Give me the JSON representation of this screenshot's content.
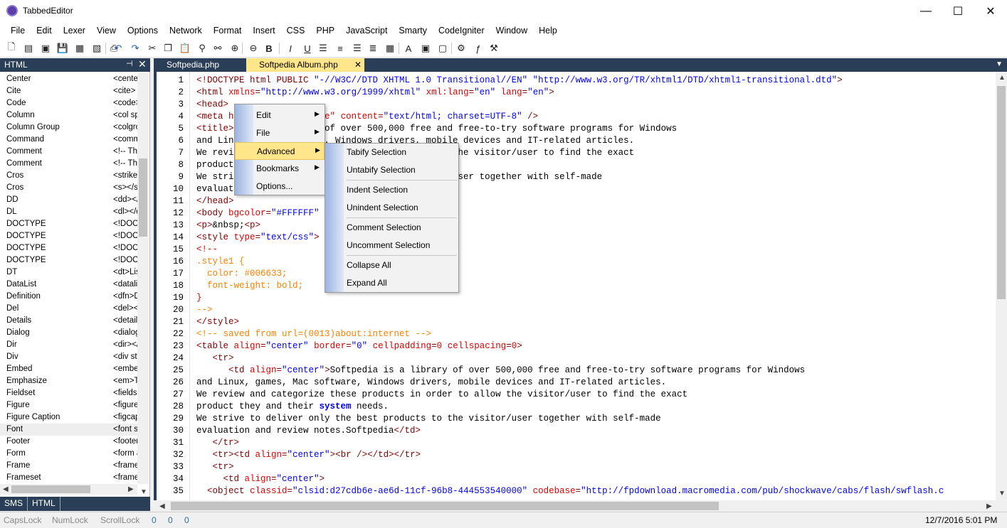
{
  "window": {
    "title": "TabbedEditor",
    "minimize": "—",
    "maximize": "☐",
    "close": "✕"
  },
  "menu": [
    "File",
    "Edit",
    "Lexer",
    "View",
    "Options",
    "Network",
    "Format",
    "Insert",
    "CSS",
    "PHP",
    "JavaScript",
    "Smarty",
    "CodeIgniter",
    "Window",
    "Help"
  ],
  "toolbar_icons": [
    "new-file-icon",
    "new-template-icon",
    "close-file-icon",
    "save-icon",
    "save-all-icon",
    "print-preview-icon",
    "print-icon",
    "undo-icon",
    "redo-icon",
    "cut-icon",
    "copy-icon",
    "paste-icon",
    "find-icon",
    "find-replace-icon",
    "zoom-in-icon",
    "zoom-out-icon",
    "bold-icon",
    "italic-icon",
    "underline-icon",
    "align-left-icon",
    "align-center-icon",
    "align-right-icon",
    "justify-icon",
    "table-icon",
    "font-icon",
    "image-icon",
    "comment-icon",
    "tools-icon",
    "function-icon",
    "run-icon"
  ],
  "panel": {
    "title": "HTML",
    "pin": "⊣",
    "close": "✕",
    "items": [
      {
        "name": "Center",
        "value": "<center"
      },
      {
        "name": "Cite",
        "value": "<cite>"
      },
      {
        "name": "Code",
        "value": "<code>"
      },
      {
        "name": "Column",
        "value": "<col sp"
      },
      {
        "name": "Column Group",
        "value": "<colgro"
      },
      {
        "name": "Command",
        "value": "<comm"
      },
      {
        "name": "Comment",
        "value": "<!-- Thi"
      },
      {
        "name": "Comment",
        "value": "<!-- Thi"
      },
      {
        "name": "Cros",
        "value": "<strike"
      },
      {
        "name": "Cros",
        "value": "<s></s"
      },
      {
        "name": "DD",
        "value": "<dd></"
      },
      {
        "name": "DL",
        "value": "<dl></d"
      },
      {
        "name": "DOCTYPE",
        "value": "<!DOC"
      },
      {
        "name": "DOCTYPE",
        "value": "<!DOC"
      },
      {
        "name": "DOCTYPE",
        "value": "<!DOC"
      },
      {
        "name": "DOCTYPE",
        "value": "<!DOC"
      },
      {
        "name": "DT",
        "value": "<dt>Lis"
      },
      {
        "name": "DataList",
        "value": "<datalis"
      },
      {
        "name": "Definition",
        "value": "<dfn>D"
      },
      {
        "name": "Del",
        "value": "<del><"
      },
      {
        "name": "Details",
        "value": "<details"
      },
      {
        "name": "Dialog",
        "value": "<dialog"
      },
      {
        "name": "Dir",
        "value": "<dir></"
      },
      {
        "name": "Div",
        "value": "<div sty"
      },
      {
        "name": "Embed",
        "value": "<embe"
      },
      {
        "name": "Emphasize",
        "value": "<em>T"
      },
      {
        "name": "Fieldset",
        "value": "<fieldse"
      },
      {
        "name": "Figure",
        "value": "<figure"
      },
      {
        "name": "Figure Caption",
        "value": "<figcap"
      },
      {
        "name": "Font",
        "value": "<font s"
      },
      {
        "name": "Footer",
        "value": "<footer"
      },
      {
        "name": "Form",
        "value": "<form a"
      },
      {
        "name": "Frame",
        "value": "<frame"
      },
      {
        "name": "Frameset",
        "value": "<frame"
      }
    ],
    "selected_index": 29,
    "tabs": [
      "SMS",
      "HTML"
    ]
  },
  "tabs": [
    {
      "label": "Softpedia.php",
      "active": false
    },
    {
      "label": "Softpedia Album.php",
      "active": true
    }
  ],
  "tab_close": "✕",
  "code_lines": [
    {
      "n": "1",
      "segs": [
        [
          "tag",
          "<!DOCTYPE html PUBLIC "
        ],
        [
          "str",
          "\"-//W3C//DTD XHTML 1.0 Transitional//EN\""
        ],
        [
          "text",
          " "
        ],
        [
          "str",
          "\"http://www.w3.org/TR/xhtml1/DTD/xhtml1-transitional.dtd\""
        ],
        [
          "tag",
          ">"
        ]
      ]
    },
    {
      "n": "2",
      "segs": [
        [
          "tag",
          "<html "
        ],
        [
          "attr",
          "xmlns"
        ],
        [
          "tag",
          "="
        ],
        [
          "str",
          "\"http://www.w3.org/1999/xhtml\""
        ],
        [
          "tag",
          " "
        ],
        [
          "attr",
          "xml:lang"
        ],
        [
          "tag",
          "="
        ],
        [
          "str",
          "\"en\""
        ],
        [
          "tag",
          " "
        ],
        [
          "attr",
          "lang"
        ],
        [
          "tag",
          "="
        ],
        [
          "str",
          "\"en\""
        ],
        [
          "tag",
          ">"
        ]
      ]
    },
    {
      "n": "3",
      "segs": [
        [
          "tag",
          "<head>"
        ]
      ]
    },
    {
      "n": "4",
      "segs": [
        [
          "tag",
          "<meta h"
        ],
        [
          "text",
          "          "
        ],
        [
          "attr",
          "ent-Type\""
        ],
        [
          "tag",
          " "
        ],
        [
          "attr",
          "content"
        ],
        [
          "tag",
          "="
        ],
        [
          "str",
          "\"text/html; charset=UTF-8\""
        ],
        [
          "tag",
          " />"
        ]
      ]
    },
    {
      "n": "5",
      "segs": [
        [
          "tag",
          "<title>"
        ],
        [
          "text",
          "          ibrary of over 500,000 free and free-to-try software programs for Windows"
        ]
      ]
    },
    {
      "n": "6",
      "segs": [
        [
          "text",
          "and Lin          oftware, Windows drivers, mobile devices and IT-related articles."
        ]
      ]
    },
    {
      "n": "7",
      "segs": [
        [
          "text",
          "We revi                             er to allow the visitor/user to find the exact"
        ]
      ]
    },
    {
      "n": "8",
      "segs": [
        [
          "text",
          "product"
        ]
      ]
    },
    {
      "n": "9",
      "segs": [
        [
          "text",
          "We stri                             the visitor/user together with self-made"
        ]
      ]
    },
    {
      "n": "10",
      "segs": [
        [
          "text",
          "evaluat"
        ]
      ]
    },
    {
      "n": "11",
      "segs": [
        [
          "tag",
          "</head>"
        ]
      ]
    },
    {
      "n": "12",
      "segs": [
        [
          "tag",
          "<body "
        ],
        [
          "attr",
          "bgcolor"
        ],
        [
          "tag",
          "="
        ],
        [
          "str",
          "\"#FFFFFF\""
        ]
      ]
    },
    {
      "n": "13",
      "segs": [
        [
          "tag",
          "<p>"
        ],
        [
          "text",
          "&nbsp;"
        ],
        [
          "tag",
          "<p>"
        ]
      ]
    },
    {
      "n": "14",
      "segs": [
        [
          "tag",
          "<style "
        ],
        [
          "attr",
          "type"
        ],
        [
          "tag",
          "="
        ],
        [
          "str",
          "\"text/css\""
        ],
        [
          "tag",
          ">"
        ]
      ]
    },
    {
      "n": "15",
      "segs": [
        [
          "attr",
          "<!--"
        ]
      ]
    },
    {
      "n": "16",
      "segs": [
        [
          "cmt",
          ".style1 {"
        ]
      ]
    },
    {
      "n": "17",
      "segs": [
        [
          "cmt",
          "  color: #006633;"
        ]
      ]
    },
    {
      "n": "18",
      "segs": [
        [
          "cmt",
          "  font-weight: bold;"
        ]
      ]
    },
    {
      "n": "19",
      "segs": [
        [
          "attr",
          "}"
        ]
      ]
    },
    {
      "n": "20",
      "segs": [
        [
          "cmt",
          "-->"
        ]
      ]
    },
    {
      "n": "21",
      "segs": [
        [
          "tag",
          "</style>"
        ]
      ]
    },
    {
      "n": "22",
      "segs": [
        [
          "cmt",
          "<!-- saved from url=(0013)about:internet -->"
        ]
      ]
    },
    {
      "n": "23",
      "segs": [
        [
          "tag",
          "<table "
        ],
        [
          "attr",
          "align"
        ],
        [
          "tag",
          "="
        ],
        [
          "str",
          "\"center\""
        ],
        [
          "tag",
          " "
        ],
        [
          "attr",
          "border"
        ],
        [
          "tag",
          "="
        ],
        [
          "str",
          "\"0\""
        ],
        [
          "tag",
          " "
        ],
        [
          "attr",
          "cellpadding"
        ],
        [
          "tag",
          "="
        ],
        [
          "attr",
          "0"
        ],
        [
          "tag",
          " "
        ],
        [
          "attr",
          "cellspacing"
        ],
        [
          "tag",
          "="
        ],
        [
          "attr",
          "0"
        ],
        [
          "tag",
          ">"
        ]
      ]
    },
    {
      "n": "24",
      "segs": [
        [
          "tag",
          "   <tr>"
        ]
      ]
    },
    {
      "n": "25",
      "segs": [
        [
          "tag",
          "      <td "
        ],
        [
          "attr",
          "align"
        ],
        [
          "tag",
          "="
        ],
        [
          "str",
          "\"center\""
        ],
        [
          "tag",
          ">"
        ],
        [
          "text",
          "Softpedia is a library of over 500,000 free and free-to-try software programs for Windows"
        ]
      ]
    },
    {
      "n": "26",
      "segs": [
        [
          "text",
          "and Linux, games, Mac software, Windows drivers, mobile devices and IT-related articles."
        ]
      ]
    },
    {
      "n": "27",
      "segs": [
        [
          "text",
          "We review and categorize these products in order to allow the visitor/user to find the exact"
        ]
      ]
    },
    {
      "n": "28",
      "segs": [
        [
          "text",
          "product they and their "
        ],
        [
          "kw",
          "system"
        ],
        [
          "text",
          " needs."
        ]
      ]
    },
    {
      "n": "29",
      "segs": [
        [
          "text",
          "We strive to deliver only the best products to the visitor/user together with self-made"
        ]
      ]
    },
    {
      "n": "30",
      "segs": [
        [
          "text",
          "evaluation and review notes.Softpedia"
        ],
        [
          "tag",
          "</td>"
        ]
      ]
    },
    {
      "n": "31",
      "segs": [
        [
          "tag",
          "   </tr>"
        ]
      ]
    },
    {
      "n": "32",
      "segs": [
        [
          "tag",
          "   <tr><td "
        ],
        [
          "attr",
          "align"
        ],
        [
          "tag",
          "="
        ],
        [
          "str",
          "\"center\""
        ],
        [
          "tag",
          "><br /></td></tr>"
        ]
      ]
    },
    {
      "n": "33",
      "segs": [
        [
          "tag",
          "   <tr>"
        ]
      ]
    },
    {
      "n": "34",
      "segs": [
        [
          "tag",
          "     <td "
        ],
        [
          "attr",
          "align"
        ],
        [
          "tag",
          "="
        ],
        [
          "str",
          "\"center\""
        ],
        [
          "tag",
          ">"
        ]
      ]
    },
    {
      "n": "35",
      "segs": [
        [
          "tag",
          "  <object "
        ],
        [
          "attr",
          "classid"
        ],
        [
          "tag",
          "="
        ],
        [
          "str",
          "\"clsid:d27cdb6e-ae6d-11cf-96b8-444553540000\""
        ],
        [
          "tag",
          " "
        ],
        [
          "attr",
          "codebase"
        ],
        [
          "tag",
          "="
        ],
        [
          "str",
          "\"http://fpdownload.macromedia.com/pub/shockwave/cabs/flash/swflash.c"
        ]
      ]
    }
  ],
  "context_menu": {
    "items": [
      {
        "label": "Edit",
        "submenu": true,
        "highlight": false
      },
      {
        "label": "File",
        "submenu": true,
        "highlight": false
      },
      {
        "label": "Advanced",
        "submenu": true,
        "highlight": true
      },
      {
        "label": "Bookmarks",
        "submenu": true,
        "highlight": false
      },
      {
        "label": "Options...",
        "submenu": false,
        "highlight": false
      }
    ],
    "arrow": "▶"
  },
  "submenu": {
    "groups": [
      [
        "Tabify Selection",
        "Untabify Selection"
      ],
      [
        "Indent Selection",
        "Unindent Selection"
      ],
      [
        "Comment Selection",
        "Uncomment Selection"
      ],
      [
        "Collapse All",
        "Expand All"
      ]
    ]
  },
  "status": {
    "caps": "CapsLock",
    "num": "NumLock",
    "scroll": "ScrollLock",
    "v1": "0",
    "v2": "0",
    "v3": "0",
    "datetime": "12/7/2016 5:01 PM"
  }
}
